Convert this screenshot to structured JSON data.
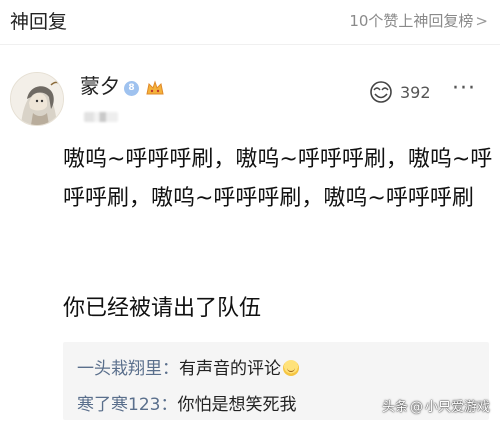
{
  "header": {
    "title": "神回复",
    "top_list_label": "10个赞上神回复榜",
    "chevron": ">"
  },
  "comment": {
    "username": "蒙夕",
    "vip_level": "8",
    "likes": "392",
    "more": "···",
    "body": "嗷呜~呼呼呼刷，嗷呜~呼呼呼刷，嗷呜~呼呼呼刷，嗷呜~呼呼呼刷，嗷呜~呼呼呼刷",
    "body2": "你已经被请出了队伍"
  },
  "replies": [
    {
      "name": "一头栽翔里",
      "sep": "：",
      "text": "有声音的评论"
    },
    {
      "name": "寒了寒123",
      "sep": "：",
      "text": "你怕是想笑死我"
    }
  ],
  "watermark": {
    "source": "头条",
    "at": "@",
    "author": "小只爱游戏"
  },
  "icons": {
    "avatar": "avatar-illustration",
    "vip": "vip-level-badge",
    "fan": "fan-badge-icon",
    "like": "like-icon",
    "more": "more-icon",
    "emoji": "smile-emoji"
  },
  "colors": {
    "reply_name": "#5a6f8c",
    "muted": "#8a8a8a",
    "reply_bg": "#f5f5f5",
    "vip": "#9fc2ef"
  }
}
